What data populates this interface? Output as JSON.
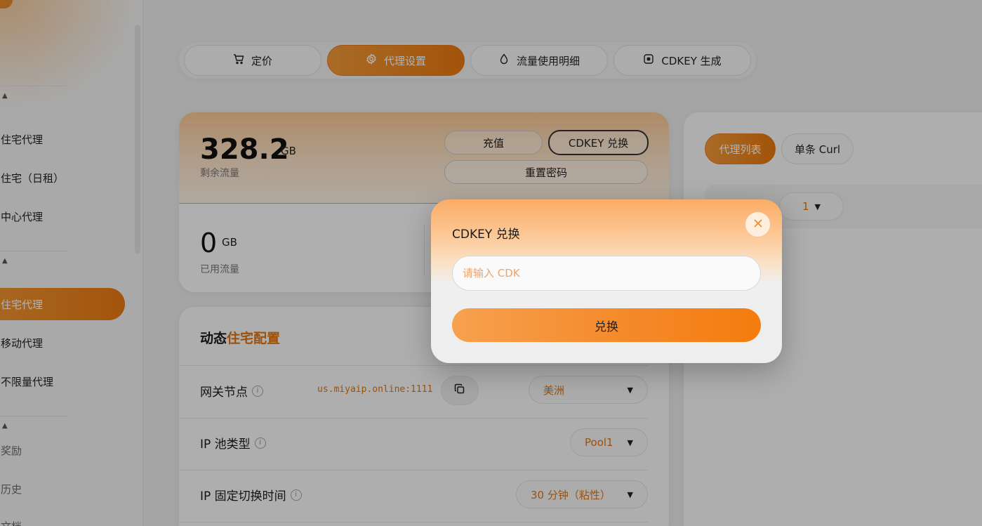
{
  "sidebar": {
    "groups": [
      {
        "items": [
          {
            "label": "住宅代理"
          },
          {
            "label": "住宅（日租）"
          },
          {
            "label": "中心代理"
          }
        ]
      },
      {
        "items": [
          {
            "label": "住宅代理",
            "active": true
          },
          {
            "label": "移动代理"
          },
          {
            "label": "不限量代理"
          }
        ]
      },
      {
        "items": [
          {
            "label": "奖励"
          },
          {
            "label": "历史"
          },
          {
            "label": "文档"
          }
        ]
      }
    ],
    "caret": "▲"
  },
  "tabs": [
    {
      "label": "定价",
      "icon": "cart-icon"
    },
    {
      "label": "代理设置",
      "icon": "gear-icon",
      "active": true
    },
    {
      "label": "流量使用明细",
      "icon": "droplet-icon"
    },
    {
      "label": "CDKEY 生成",
      "icon": "key-chip-icon"
    }
  ],
  "balance": {
    "remaining_value": "328.2",
    "remaining_unit": "GB",
    "remaining_label": "剩余流量",
    "used_value": "0",
    "used_unit": "GB",
    "used_label": "已用流量",
    "recharge_label": "充值",
    "cdkey_redeem_label": "CDKEY 兑换",
    "reset_password_label": "重置密码"
  },
  "config": {
    "title_prefix": "动态",
    "title_accent": "住宅配置",
    "rows": [
      {
        "label": "网关节点",
        "value": "us.miyaip.online:1111",
        "select": "美洲"
      },
      {
        "label": "IP 池类型",
        "select": "Pool1"
      },
      {
        "label": "IP 固定切换时间",
        "select": "30 分钟（粘性）"
      }
    ],
    "info_glyph": "i"
  },
  "right_panel": {
    "proxy_list_label": "代理列表",
    "single_curl_label": "单条 Curl",
    "page_value": "1"
  },
  "modal": {
    "title": "CDKEY 兑换",
    "input_placeholder": "请输入 CDK",
    "input_value": "",
    "submit_label": "兑换",
    "close_glyph": "✕"
  },
  "colors": {
    "accent": "#e9780f",
    "accent_light": "#f29a38",
    "text_accent": "#e4730d"
  }
}
